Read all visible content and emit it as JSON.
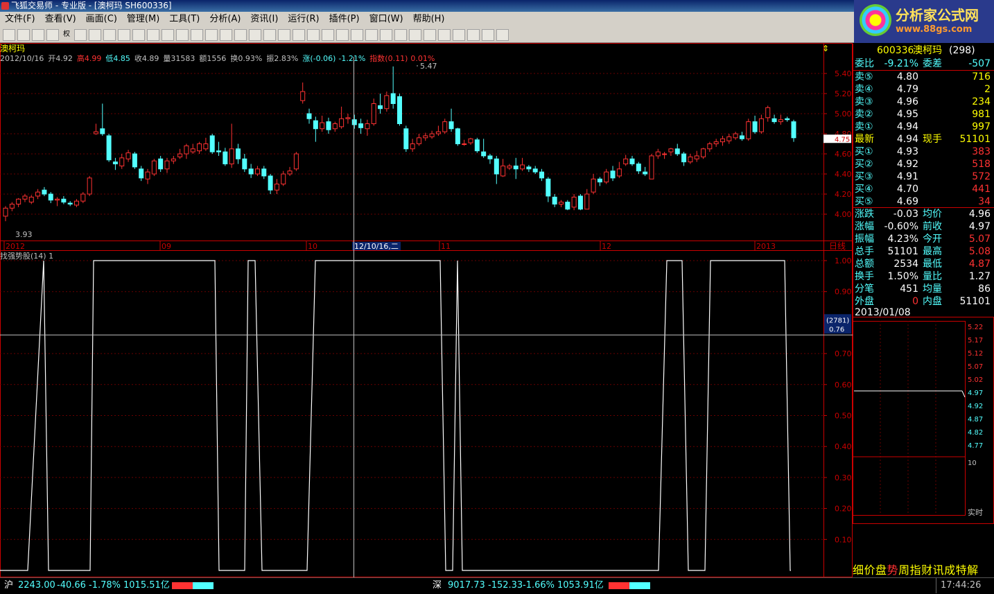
{
  "window": {
    "title": "飞狐交易师 - 专业版 - [澳柯玛 SH600336]"
  },
  "menu": [
    "文件(F)",
    "查看(V)",
    "画面(C)",
    "管理(M)",
    "工具(T)",
    "分析(A)",
    "资讯(I)",
    "运行(R)",
    "插件(P)",
    "窗口(W)",
    "帮助(H)"
  ],
  "toolbar": {
    "weight_label": "权"
  },
  "logo": {
    "name": "分析家公式网",
    "url": "www.88gs.com"
  },
  "chart": {
    "name": "澳柯玛",
    "info": {
      "date": "2012/10/16",
      "open_l": "开",
      "open": "4.92",
      "high_l": "高",
      "high": "4.99",
      "low_l": "低",
      "low": "4.85",
      "close_l": "收",
      "close": "4.89",
      "vol_l": "量",
      "vol": "31583",
      "amt_l": "额",
      "amt": "1556",
      "turn_l": "换",
      "turn": "0.93%",
      "amp_l": "振",
      "amp": "2.83%",
      "chg_l": "涨",
      "chg": "(-0.06)",
      "chgp": "-1.21%",
      "idx_l": "指数",
      "idx": "(0.11)",
      "idxp": "0.01%"
    },
    "max_label": "5.47",
    "min_label": "3.93",
    "price_ticks": [
      "5.40",
      "5.20",
      "5.00",
      "4.80",
      "4.60",
      "4.40",
      "4.20",
      "4.00"
    ],
    "cur_price": "4.75",
    "date_axis": [
      {
        "t": "2012"
      },
      {
        "t": "09"
      },
      {
        "t": "10"
      },
      {
        "t": "12/10/16,二"
      },
      {
        "t": "11"
      },
      {
        "t": "12"
      },
      {
        "t": "2013"
      }
    ],
    "period": "日线",
    "indicator_name": "找强势股(14) 1",
    "ind_ticks": [
      "1.00",
      "0.90",
      "0.70",
      "0.60",
      "0.50",
      "0.40",
      "0.30",
      "0.20",
      "0.10"
    ],
    "cursor_count": "(2781)",
    "cursor_value": "0.76"
  },
  "quote": {
    "code": "600336",
    "name": "澳柯玛",
    "num": "(298)",
    "wb_l": "委比",
    "wb": "-9.21%",
    "wc_l": "委差",
    "wc": "-507",
    "sells": [
      {
        "l": "卖⑤",
        "p": "4.80",
        "v": "716"
      },
      {
        "l": "卖④",
        "p": "4.79",
        "v": "2"
      },
      {
        "l": "卖③",
        "p": "4.96",
        "v": "234"
      },
      {
        "l": "卖②",
        "p": "4.95",
        "v": "981"
      },
      {
        "l": "卖①",
        "p": "4.94",
        "v": "997"
      }
    ],
    "last_l": "最新",
    "last": "4.94",
    "cur_l": "现手",
    "cur": "51101",
    "buys": [
      {
        "l": "买①",
        "p": "4.93",
        "v": "383"
      },
      {
        "l": "买②",
        "p": "4.92",
        "v": "518"
      },
      {
        "l": "买③",
        "p": "4.91",
        "v": "572"
      },
      {
        "l": "买④",
        "p": "4.70",
        "v": "441"
      },
      {
        "l": "买⑤",
        "p": "4.69",
        "v": "34"
      }
    ],
    "stats": [
      {
        "a": "涨跌",
        "av": "-0.03",
        "b": "均价",
        "bv": "4.96"
      },
      {
        "a": "涨幅",
        "av": "-0.60%",
        "b": "前收",
        "bv": "4.97"
      },
      {
        "a": "振幅",
        "av": "4.23%",
        "b": "今开",
        "bv": "5.07"
      },
      {
        "a": "总手",
        "av": "51101",
        "b": "最高",
        "bv": "5.08"
      },
      {
        "a": "总额",
        "av": "2534",
        "b": "最低",
        "bv": "4.87"
      },
      {
        "a": "换手",
        "av": "1.50%",
        "b": "量比",
        "bv": "1.27"
      },
      {
        "a": "分笔",
        "av": "451",
        "b": "均量",
        "bv": "86"
      },
      {
        "a": "外盘",
        "av": "0",
        "b": "内盘",
        "bv": "51101"
      }
    ],
    "mini_date": "2013/01/08",
    "mini_ticks": [
      "5.22",
      "5.17",
      "5.12",
      "5.07",
      "5.02",
      "4.97",
      "4.92",
      "4.87",
      "4.82",
      "4.77"
    ],
    "mini_vol": "10",
    "mini_rt": "实时",
    "tabs": [
      "细",
      "价",
      "盘",
      "势",
      "周",
      "指",
      "财",
      "讯",
      "成",
      "特",
      "解"
    ]
  },
  "status": {
    "sh_l": "沪",
    "sh_idx": "2243.00",
    "sh_chg": "-40.66",
    "sh_pct": "-1.78%",
    "sh_amt": "1015.51亿",
    "sz_l": "深",
    "sz_idx": "9017.73",
    "sz_chg": "-152.33",
    "sz_pct": "-1.66%",
    "sz_amt": "1053.91亿",
    "time": "17:44:26"
  },
  "chart_data": {
    "type": "candlestick",
    "candles": [
      [
        3.98,
        4.06,
        4.08,
        3.93
      ],
      [
        4.06,
        4.1,
        4.12,
        4.03
      ],
      [
        4.1,
        4.15,
        4.16,
        4.07
      ],
      [
        4.15,
        4.18,
        4.2,
        4.12
      ],
      [
        4.12,
        4.17,
        4.19,
        4.1
      ],
      [
        4.18,
        4.22,
        4.25,
        4.15
      ],
      [
        4.24,
        4.2,
        4.27,
        4.18
      ],
      [
        4.2,
        4.14,
        4.22,
        4.11
      ],
      [
        4.14,
        4.15,
        4.17,
        4.08
      ],
      [
        4.15,
        4.12,
        4.18,
        4.1
      ],
      [
        4.11,
        4.1,
        4.13,
        4.08
      ],
      [
        4.09,
        4.13,
        4.15,
        4.07
      ],
      [
        4.13,
        4.2,
        4.22,
        4.11
      ],
      [
        4.2,
        4.36,
        4.38,
        4.18
      ],
      [
        4.8,
        4.82,
        4.9,
        4.79
      ],
      [
        4.85,
        4.8,
        5.1,
        4.78
      ],
      [
        4.78,
        4.54,
        4.8,
        4.52
      ],
      [
        4.52,
        4.5,
        4.56,
        4.44
      ],
      [
        4.48,
        4.56,
        4.6,
        4.45
      ],
      [
        4.55,
        4.61,
        4.64,
        4.52
      ],
      [
        4.6,
        4.47,
        4.62,
        4.45
      ],
      [
        4.45,
        4.36,
        4.48,
        4.33
      ],
      [
        4.35,
        4.42,
        4.45,
        4.3
      ],
      [
        4.4,
        4.53,
        4.55,
        4.38
      ],
      [
        4.55,
        4.45,
        4.58,
        4.42
      ],
      [
        4.45,
        4.53,
        4.56,
        4.41
      ],
      [
        4.53,
        4.55,
        4.58,
        4.5
      ],
      [
        4.57,
        4.6,
        4.65,
        4.55
      ],
      [
        4.6,
        4.68,
        4.7,
        4.55
      ],
      [
        4.62,
        4.65,
        4.7,
        4.6
      ],
      [
        4.63,
        4.7,
        4.72,
        4.6
      ],
      [
        4.65,
        4.7,
        4.76,
        4.63
      ],
      [
        4.78,
        4.62,
        4.8,
        4.6
      ],
      [
        4.63,
        4.62,
        4.72,
        4.58
      ],
      [
        4.62,
        4.5,
        4.66,
        4.48
      ],
      [
        4.5,
        4.65,
        4.9,
        4.46
      ],
      [
        4.65,
        4.55,
        4.7,
        4.5
      ],
      [
        4.55,
        4.45,
        4.6,
        4.42
      ],
      [
        4.45,
        4.4,
        4.5,
        4.36
      ],
      [
        4.4,
        4.45,
        4.48,
        4.38
      ],
      [
        4.45,
        4.38,
        4.48,
        4.35
      ],
      [
        4.38,
        4.24,
        4.4,
        4.2
      ],
      [
        4.24,
        4.3,
        4.35,
        4.2
      ],
      [
        4.3,
        4.4,
        4.43,
        4.28
      ],
      [
        4.4,
        4.43,
        4.47,
        4.38
      ],
      [
        4.45,
        4.6,
        4.62,
        4.43
      ],
      [
        5.13,
        5.22,
        5.31,
        5.1
      ],
      [
        5.0,
        4.95,
        5.05,
        4.9
      ],
      [
        4.93,
        4.85,
        4.97,
        4.72
      ],
      [
        4.85,
        4.91,
        4.98,
        4.82
      ],
      [
        4.92,
        4.84,
        4.96,
        4.8
      ],
      [
        4.85,
        4.9,
        4.92,
        4.82
      ],
      [
        4.87,
        4.95,
        5.07,
        4.85
      ],
      [
        4.95,
        4.96,
        5.0,
        4.9
      ],
      [
        4.94,
        4.89,
        4.99,
        4.85
      ],
      [
        4.9,
        4.86,
        4.95,
        4.8
      ],
      [
        4.85,
        4.9,
        4.94,
        4.78
      ],
      [
        4.9,
        5.1,
        5.15,
        4.88
      ],
      [
        5.08,
        5.05,
        5.2,
        5.0
      ],
      [
        5.05,
        5.18,
        5.22,
        5.02
      ],
      [
        5.2,
        5.1,
        5.47,
        5.05
      ],
      [
        5.17,
        4.9,
        5.2,
        4.88
      ],
      [
        4.85,
        4.65,
        4.88,
        4.62
      ],
      [
        4.65,
        4.7,
        4.75,
        4.62
      ],
      [
        4.7,
        4.76,
        4.8,
        4.68
      ],
      [
        4.76,
        4.78,
        4.81,
        4.73
      ],
      [
        4.77,
        4.8,
        4.83,
        4.75
      ],
      [
        4.8,
        4.82,
        4.88,
        4.78
      ],
      [
        4.82,
        4.92,
        4.95,
        4.8
      ],
      [
        4.92,
        4.85,
        5.05,
        4.82
      ],
      [
        4.85,
        4.7,
        4.86,
        4.68
      ],
      [
        4.7,
        4.7,
        4.74,
        4.68
      ],
      [
        4.71,
        4.75,
        4.76,
        4.69
      ],
      [
        4.74,
        4.63,
        4.76,
        4.61
      ],
      [
        4.62,
        4.58,
        4.75,
        4.56
      ],
      [
        4.58,
        4.55,
        4.6,
        4.5
      ],
      [
        4.55,
        4.4,
        4.58,
        4.3
      ],
      [
        4.38,
        4.48,
        4.55,
        4.37
      ],
      [
        4.46,
        4.48,
        4.5,
        4.44
      ],
      [
        4.48,
        4.45,
        4.56,
        4.35
      ],
      [
        4.45,
        4.49,
        4.56,
        4.43
      ],
      [
        4.47,
        4.45,
        4.49,
        4.42
      ],
      [
        4.45,
        4.42,
        4.48,
        4.4
      ],
      [
        4.42,
        4.36,
        4.45,
        4.33
      ],
      [
        4.35,
        4.18,
        4.37,
        4.12
      ],
      [
        4.17,
        4.1,
        4.2,
        4.07
      ],
      [
        4.1,
        4.12,
        4.14,
        4.07
      ],
      [
        4.12,
        4.05,
        4.14,
        4.04
      ],
      [
        4.07,
        4.17,
        4.2,
        4.04
      ],
      [
        4.18,
        4.05,
        4.2,
        4.04
      ],
      [
        4.05,
        4.2,
        4.25,
        4.05
      ],
      [
        4.22,
        4.35,
        4.4,
        4.2
      ],
      [
        4.35,
        4.32,
        4.37,
        4.28
      ],
      [
        4.32,
        4.42,
        4.45,
        4.3
      ],
      [
        4.43,
        4.36,
        4.48,
        4.33
      ],
      [
        4.38,
        4.45,
        4.52,
        4.36
      ],
      [
        4.5,
        4.55,
        4.59,
        4.48
      ],
      [
        4.55,
        4.5,
        4.58,
        4.48
      ],
      [
        4.5,
        4.43,
        4.52,
        4.4
      ],
      [
        4.42,
        4.4,
        4.47,
        4.38
      ],
      [
        4.35,
        4.58,
        4.6,
        4.35
      ],
      [
        4.58,
        4.62,
        4.65,
        4.55
      ],
      [
        4.6,
        4.6,
        4.62,
        4.55
      ],
      [
        4.62,
        4.65,
        4.66,
        4.58
      ],
      [
        4.65,
        4.6,
        4.7,
        4.58
      ],
      [
        4.6,
        4.52,
        4.62,
        4.48
      ],
      [
        4.52,
        4.57,
        4.6,
        4.5
      ],
      [
        4.55,
        4.58,
        4.63,
        4.52
      ],
      [
        4.57,
        4.65,
        4.66,
        4.55
      ],
      [
        4.65,
        4.7,
        4.72,
        4.62
      ],
      [
        4.7,
        4.72,
        4.75,
        4.67
      ],
      [
        4.72,
        4.75,
        4.78,
        4.68
      ],
      [
        4.73,
        4.77,
        4.8,
        4.7
      ],
      [
        4.76,
        4.8,
        4.82,
        4.74
      ],
      [
        4.78,
        4.75,
        4.82,
        4.73
      ],
      [
        4.75,
        4.92,
        4.95,
        4.73
      ],
      [
        4.92,
        4.82,
        4.98,
        4.8
      ],
      [
        4.82,
        4.95,
        4.99,
        4.8
      ],
      [
        4.96,
        5.06,
        5.08,
        4.92
      ],
      [
        4.95,
        4.92,
        4.99,
        4.9
      ],
      [
        4.92,
        4.94,
        4.99,
        4.89
      ],
      [
        4.95,
        4.94,
        4.97,
        4.92
      ],
      [
        4.92,
        4.76,
        4.94,
        4.72
      ]
    ],
    "indicator": {
      "name": "找强势股(14)",
      "ylim": [
        0,
        1
      ],
      "segments": [
        [
          0,
          0
        ],
        [
          40,
          0
        ],
        [
          63,
          1
        ],
        [
          70,
          0
        ],
        [
          130,
          0
        ],
        [
          135,
          1
        ],
        [
          310,
          1
        ],
        [
          316,
          0
        ],
        [
          353,
          0
        ],
        [
          358,
          1
        ],
        [
          368,
          1
        ],
        [
          378,
          0
        ],
        [
          443,
          0
        ],
        [
          455,
          1
        ],
        [
          635,
          1
        ],
        [
          643,
          0
        ],
        [
          653,
          0
        ],
        [
          660,
          1
        ],
        [
          667,
          0
        ],
        [
          675,
          0
        ],
        [
          950,
          0
        ],
        [
          962,
          1
        ],
        [
          984,
          1
        ],
        [
          993,
          0
        ],
        [
          1017,
          0
        ],
        [
          1025,
          1
        ],
        [
          1132,
          1
        ],
        [
          1140,
          0
        ],
        [
          1141,
          0
        ]
      ]
    }
  }
}
